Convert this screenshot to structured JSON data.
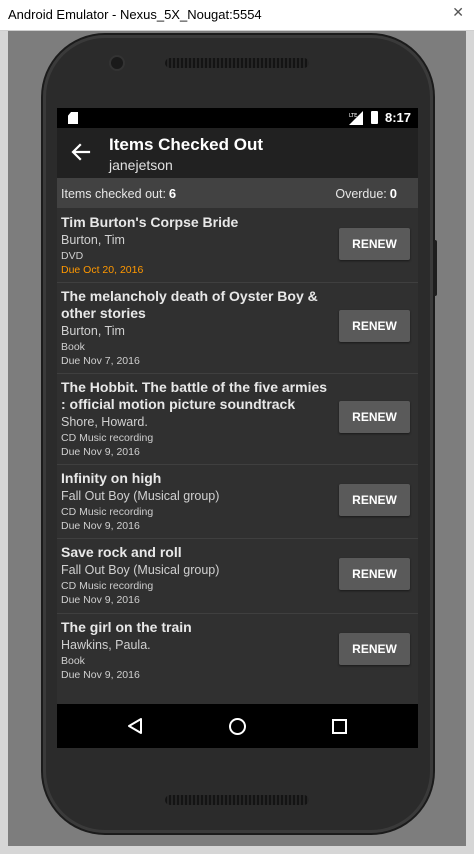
{
  "window": {
    "title": "Android Emulator - Nexus_5X_Nougat:5554",
    "close_glyph": "✕"
  },
  "statusbar": {
    "time": "8:17",
    "network_label": "LTE"
  },
  "appbar": {
    "title": "Items Checked Out",
    "subtitle": "janejetson"
  },
  "summary": {
    "checked_out_label": "Items checked out:",
    "checked_out_count": "6",
    "overdue_label": "Overdue:",
    "overdue_count": "0"
  },
  "items": [
    {
      "title": "Tim Burton's Corpse Bride",
      "author": "Burton, Tim",
      "format": "DVD",
      "due": "Due Oct 20, 2016",
      "due_highlight": true,
      "renew_label": "RENEW"
    },
    {
      "title": "The melancholy death of Oyster Boy & other stories",
      "author": "Burton, Tim",
      "format": "Book",
      "due": "Due Nov 7, 2016",
      "due_highlight": false,
      "renew_label": "RENEW"
    },
    {
      "title": "The Hobbit. The battle of the five armies : official motion picture soundtrack",
      "author": "Shore, Howard.",
      "format": "CD Music recording",
      "due": "Due Nov 9, 2016",
      "due_highlight": false,
      "renew_label": "RENEW"
    },
    {
      "title": "Infinity on high",
      "author": "Fall Out Boy (Musical group)",
      "format": "CD Music recording",
      "due": "Due Nov 9, 2016",
      "due_highlight": false,
      "renew_label": "RENEW"
    },
    {
      "title": "Save rock and roll",
      "author": "Fall Out Boy (Musical group)",
      "format": "CD Music recording",
      "due": "Due Nov 9, 2016",
      "due_highlight": false,
      "renew_label": "RENEW"
    },
    {
      "title": "The girl on the train",
      "author": "Hawkins, Paula.",
      "format": "Book",
      "due": "Due Nov 9, 2016",
      "due_highlight": false,
      "renew_label": "RENEW"
    }
  ],
  "colors": {
    "overdue_due_text": "#ff9800",
    "appbar": "#212121",
    "screen_bg": "#303030"
  },
  "icons": {
    "back": "arrow-left-icon",
    "nav_back": "triangle-back-icon",
    "nav_home": "circle-home-icon",
    "nav_recent": "square-recents-icon"
  }
}
